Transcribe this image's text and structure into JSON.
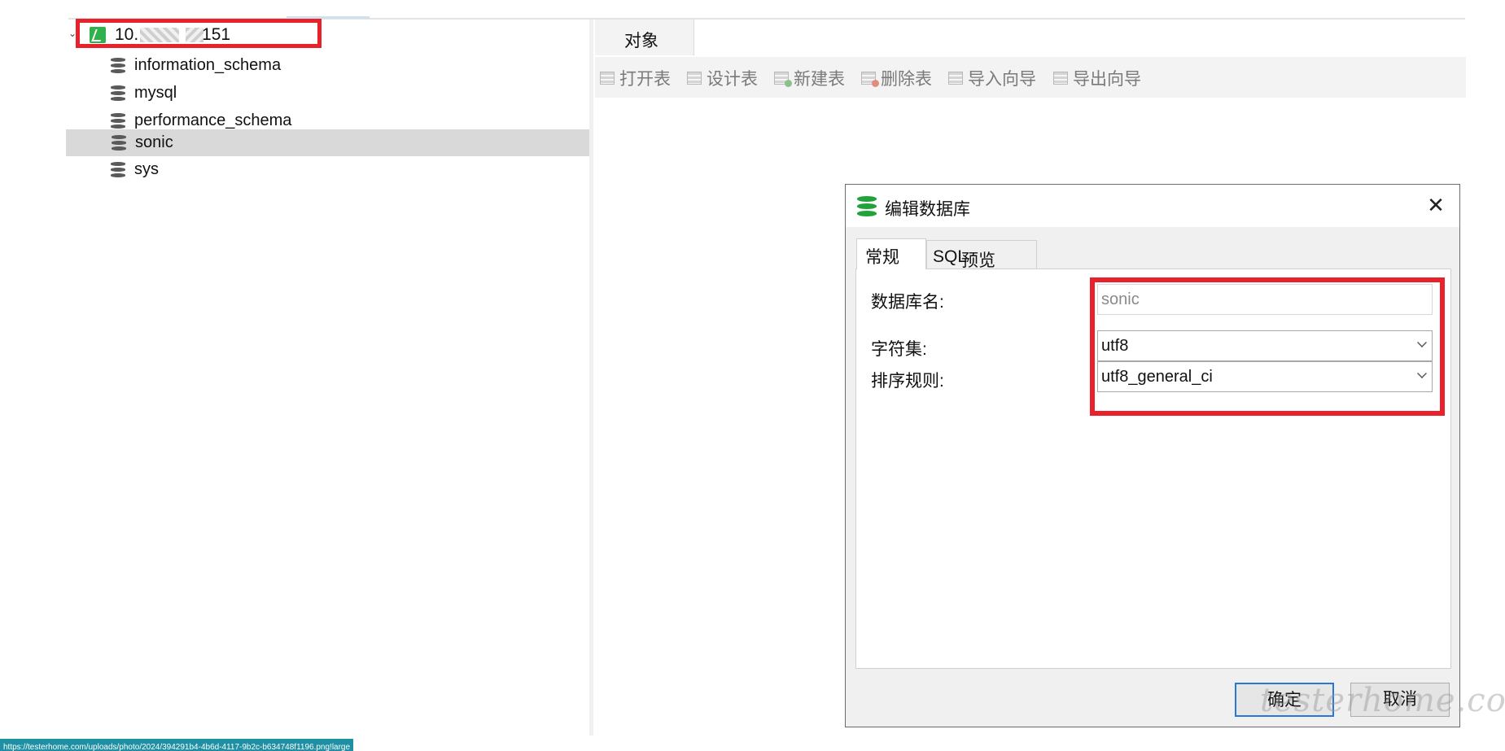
{
  "tree": {
    "connection_label_prefix": "10.",
    "connection_label_suffix": ".151",
    "databases": [
      {
        "label": "information_schema"
      },
      {
        "label": "mysql"
      },
      {
        "label": "performance_schema"
      },
      {
        "label": "sonic",
        "selected": true
      },
      {
        "label": "sys"
      }
    ]
  },
  "main": {
    "tab_label": "对象",
    "toolbar": {
      "open_table": "打开表",
      "design_table": "设计表",
      "new_table": "新建表",
      "delete_table": "删除表",
      "import_wizard": "导入向导",
      "export_wizard": "导出向导"
    }
  },
  "dialog": {
    "title": "编辑数据库",
    "close_icon": "close-icon",
    "tabs": {
      "general": "常规",
      "sql_preview_prefix": "SQL",
      "sql_preview": "预览"
    },
    "fields": {
      "db_name_label": "数据库名:",
      "db_name_value": "sonic",
      "charset_label": "字符集:",
      "charset_value": "utf8",
      "collation_label": "排序规则:",
      "collation_value": "utf8_general_ci"
    },
    "ok_label": "确定",
    "cancel_label": "取消"
  },
  "watermark": {
    "text": "testerhome.com"
  },
  "statusbar": {
    "url": "https://testerhome.com/uploads/photo/2024/394291b4-4b6d-4117-9b2c-b634748f1196.png!large"
  },
  "colors": {
    "highlight_red": "#e8212b",
    "connection_green": "#2fb24c",
    "db_icon_green": "#22a23a",
    "primary_button_border": "#2a78d4",
    "statusbar": "#1f8fa3"
  }
}
